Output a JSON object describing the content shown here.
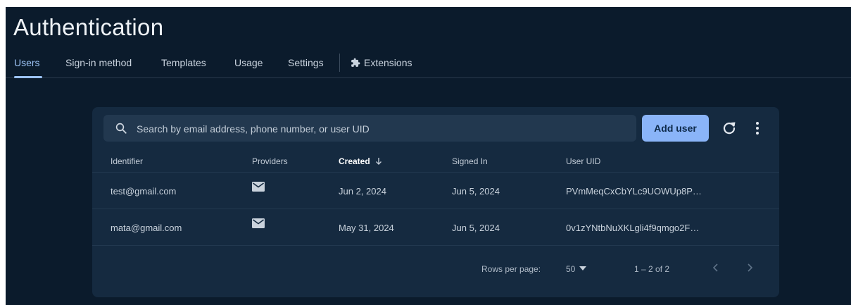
{
  "page": {
    "title": "Authentication"
  },
  "tabs": [
    {
      "label": "Users",
      "active": true
    },
    {
      "label": "Sign-in method"
    },
    {
      "label": "Templates"
    },
    {
      "label": "Usage"
    },
    {
      "label": "Settings"
    },
    {
      "label": "Extensions",
      "icon": "extensions-icon"
    }
  ],
  "toolbar": {
    "search_placeholder": "Search by email address, phone number, or user UID",
    "add_user_label": "Add user",
    "refresh_icon": "refresh-icon",
    "more_icon": "more-vert-icon"
  },
  "table": {
    "columns": [
      "Identifier",
      "Providers",
      "Created",
      "Signed In",
      "User UID"
    ],
    "sorted_column": "Created",
    "sort_direction": "descending",
    "rows": [
      {
        "identifier": "test@gmail.com",
        "provider_icon": "mail-icon",
        "created": "Jun 2, 2024",
        "signed_in": "Jun 5, 2024",
        "uid": "PVmMeqCxCbYLc9UOWUp8P…"
      },
      {
        "identifier": "mata@gmail.com",
        "provider_icon": "mail-icon",
        "created": "May 31, 2024",
        "signed_in": "Jun 5, 2024",
        "uid": "0v1zYNtbNuXKLgli4f9qmgo2F…"
      }
    ]
  },
  "pagination": {
    "rows_per_page_label": "Rows per page:",
    "rows_per_page_value": "50",
    "range": "1 – 2 of 2"
  },
  "colors": {
    "background": "#0b1b2c",
    "card": "#152a40",
    "accent": "#8ab4f8"
  }
}
